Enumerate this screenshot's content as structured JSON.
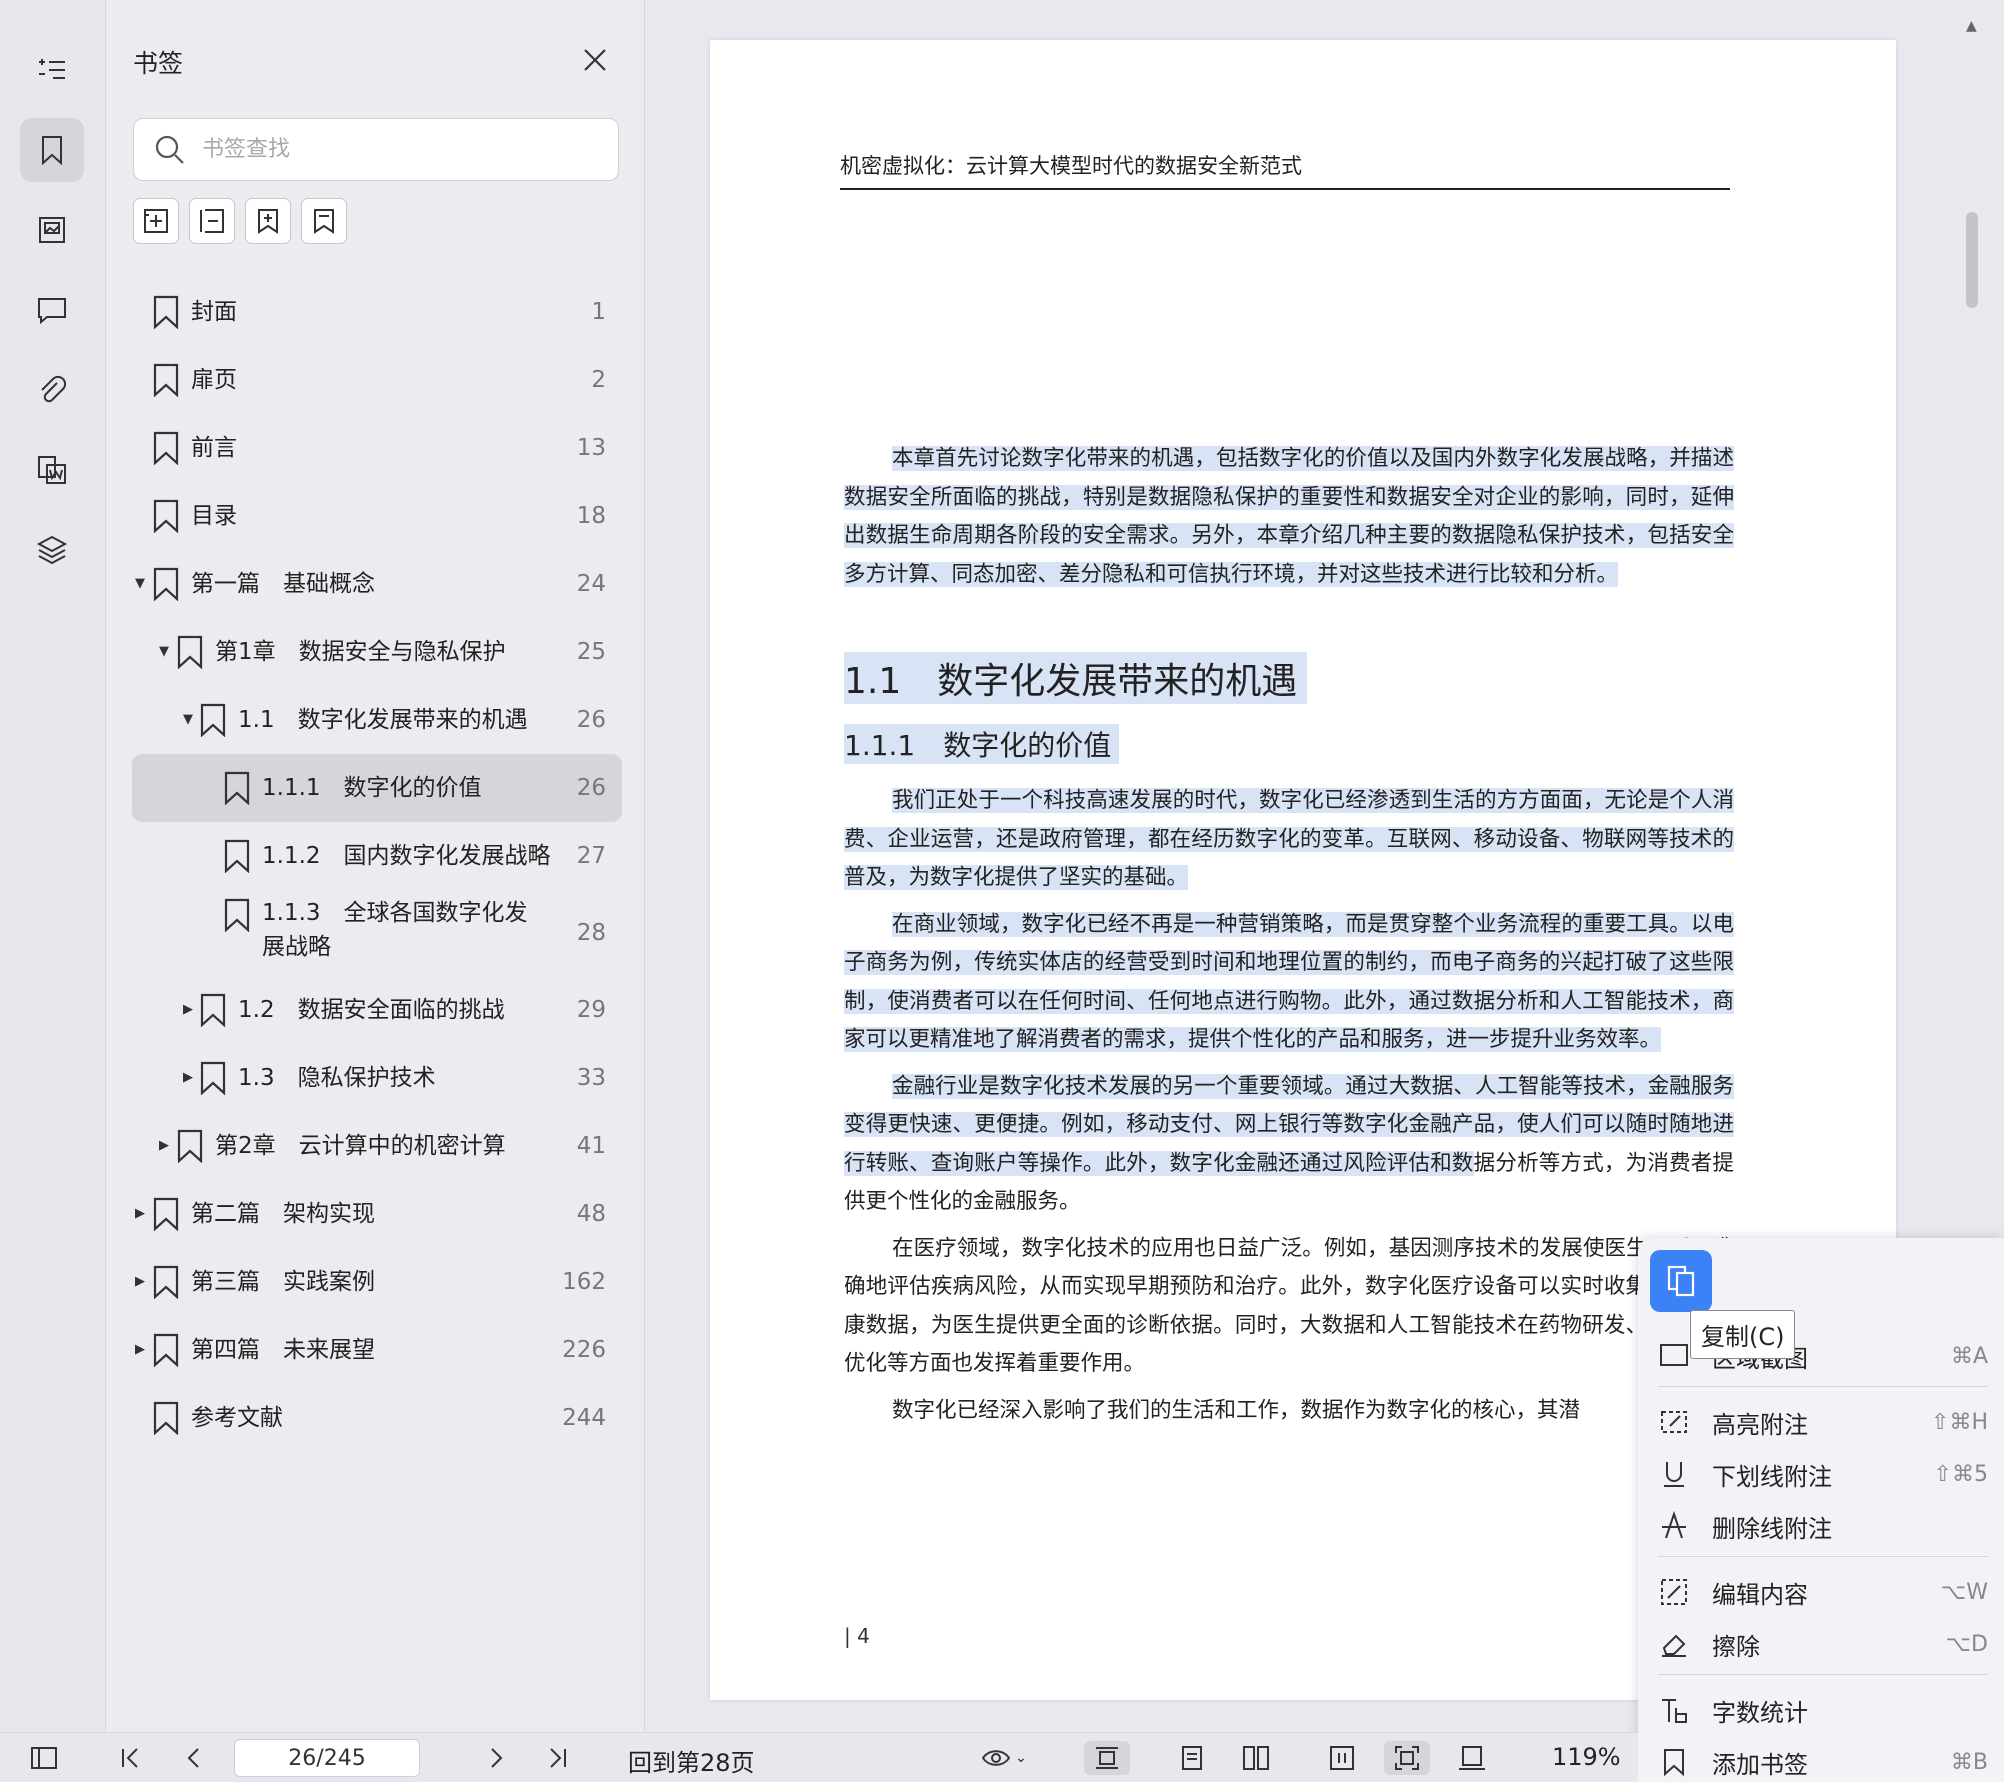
{
  "sidebar_panel": {
    "title": "书签",
    "search_placeholder": "书签查找"
  },
  "rail_icons": [
    "outline-icon",
    "bookmark-icon",
    "image-icon",
    "comment-icon",
    "attachment-icon",
    "word-convert-icon",
    "layers-icon"
  ],
  "bookmarks": [
    {
      "label": "封面",
      "page": "1"
    },
    {
      "label": "扉页",
      "page": "2"
    },
    {
      "label": "前言",
      "page": "13"
    },
    {
      "label": "目录",
      "page": "18"
    },
    {
      "label": "第一篇　基础概念",
      "page": "24"
    },
    {
      "label": "第1章　数据安全与隐私保护",
      "page": "25"
    },
    {
      "label": "1.1　数字化发展带来的机遇",
      "page": "26"
    },
    {
      "label": "1.1.1　数字化的价值",
      "page": "26"
    },
    {
      "label": "1.1.2　国内数字化发展战略",
      "page": "27"
    },
    {
      "label": "1.1.3　全球各国数字化发展战略",
      "page": "28"
    },
    {
      "label": "1.2　数据安全面临的挑战",
      "page": "29"
    },
    {
      "label": "1.3　隐私保护技术",
      "page": "33"
    },
    {
      "label": "第2章　云计算中的机密计算",
      "page": "41"
    },
    {
      "label": "第二篇　架构实现",
      "page": "48"
    },
    {
      "label": "第三篇　实践案例",
      "page": "162"
    },
    {
      "label": "第四篇　未来展望",
      "page": "226"
    },
    {
      "label": "参考文献",
      "page": "244"
    }
  ],
  "document": {
    "running_head": "机密虚拟化：云计算大模型时代的数据安全新范式",
    "intro_para": "本章首先讨论数字化带来的机遇，包括数字化的价值以及国内外数字化发展战略，并描述数据安全所面临的挑战，特别是数据隐私保护的重要性和数据安全对企业的影响，同时，延伸出数据生命周期各阶段的安全需求。另外，本章介绍几种主要的数据隐私保护技术，包括安全多方计算、同态加密、差分隐私和可信执行环境，并对这些技术进行比较和分析。",
    "h2": "1.1　数字化发展带来的机遇",
    "h3": "1.1.1　数字化的价值",
    "para1": "我们正处于一个科技高速发展的时代，数字化已经渗透到生活的方方面面，无论是个人消费、企业运营，还是政府管理，都在经历数字化的变革。互联网、移动设备、物联网等技术的普及，为数字化提供了坚实的基础。",
    "para2": "在商业领域，数字化已经不再是一种营销策略，而是贯穿整个业务流程的重要工具。以电子商务为例，传统实体店的经营受到时间和地理位置的制约，而电子商务的兴起打破了这些限制，使消费者可以在任何时间、任何地点进行购物。此外，通过数据分析和人工智能技术，商家可以更精准地了解消费者的需求，提供个性化的产品和服务，进一步提升业务效率。",
    "para3_hl": "金融行业是数字化技术发展的另一个重要领域。通过大数据、人工智能等技术，金融服务变得更快速、更便捷。例如，移动支付、网上银行等数字化金融产品，使人们可以随时随地进行转账、查询账户等操作。此外，数字化金融还通过风险评估和数",
    "para3_rest": "据分析等方式，为消费者提供更个性化的金融服务。",
    "para4": "在医疗领域，数字化技术的应用也日益广泛。例如，基因测序技术的发展使医生可以更准确地评估疾病风险，从而实现早期预防和治疗。此外，数字化医疗设备可以实时收集患者的健康数据，为医生提供更全面的诊断依据。同时，大数据和人工智能技术在药物研发、治疗方案优化等方面也发挥着重要作用。",
    "para5": "数字化已经深入影响了我们的生活和工作，数据作为数字化的核心，其潜",
    "page_number": "| 4"
  },
  "context_menu": {
    "tooltip": "复制(C)",
    "items": [
      {
        "label": "区域截图",
        "key": "⌘A"
      },
      {
        "label": "高亮附注",
        "key": "⇧⌘H"
      },
      {
        "label": "下划线附注",
        "key": "⇧⌘5"
      },
      {
        "label": "删除线附注",
        "key": ""
      },
      {
        "label": "编辑内容",
        "key": "⌥W"
      },
      {
        "label": "擦除",
        "key": "⌥D"
      },
      {
        "label": "字数统计",
        "key": ""
      },
      {
        "label": "添加书签",
        "key": "⌘B"
      }
    ]
  },
  "bottom_bar": {
    "page_value": "26/245",
    "back_to_page": "回到第28页",
    "zoom": "119%"
  }
}
